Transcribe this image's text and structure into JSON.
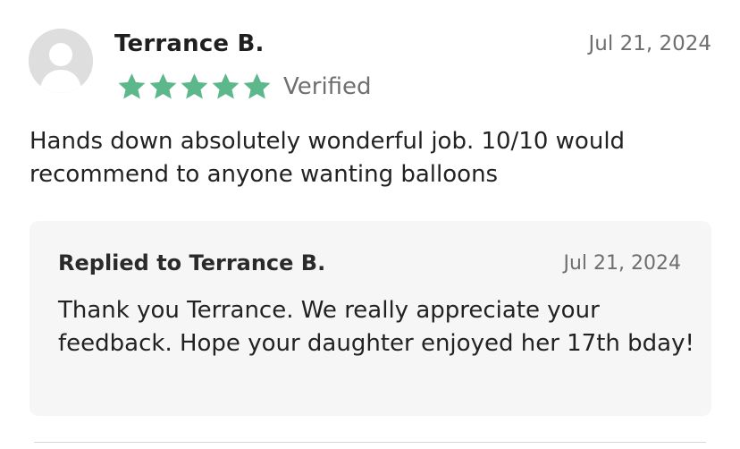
{
  "review": {
    "author": "Terrance B.",
    "date": "Jul 21, 2024",
    "rating": 5,
    "rating_max": 5,
    "verified_label": "Verified",
    "body": "Hands down absolutely wonderful job. 10/10 would recommend to anyone wanting balloons",
    "icons": {
      "avatar": "default-user-avatar-icon",
      "star": "star-icon"
    }
  },
  "reply": {
    "title": "Replied to Terrance B.",
    "date": "Jul 21, 2024",
    "body": "Thank you Terrance. We really appreciate your feedback. Hope your daughter enjoyed her 17th bday!"
  },
  "colors": {
    "star": "#5cb88a",
    "reply_background": "#f6f6f6",
    "muted_text": "#6f6f6f"
  }
}
